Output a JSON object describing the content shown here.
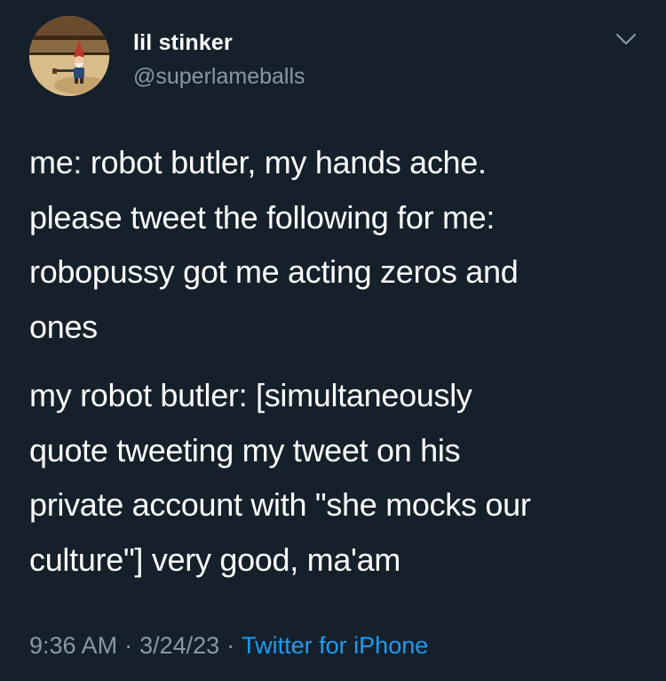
{
  "tweet": {
    "author": {
      "display_name": "lil stinker",
      "handle": "@superlameballs",
      "avatar_icon": "gnome-avatar-icon"
    },
    "menu_icon": "chevron-down-icon",
    "paragraphs": [
      "me: robot butler, my hands ache.\nplease tweet the following for me:\nrobopussy got me acting zeros and\nones",
      "my robot butler: [simultaneously\nquote tweeting my tweet on his\nprivate account with \"she mocks our\nculture\"] very good, ma'am"
    ],
    "meta": {
      "time": "9:36 AM",
      "separator": "·",
      "date": "3/24/23",
      "source": "Twitter for iPhone"
    }
  },
  "colors": {
    "background": "#15202b",
    "text": "#ffffff",
    "secondary": "#8899a6",
    "link": "#1d9bf0"
  }
}
